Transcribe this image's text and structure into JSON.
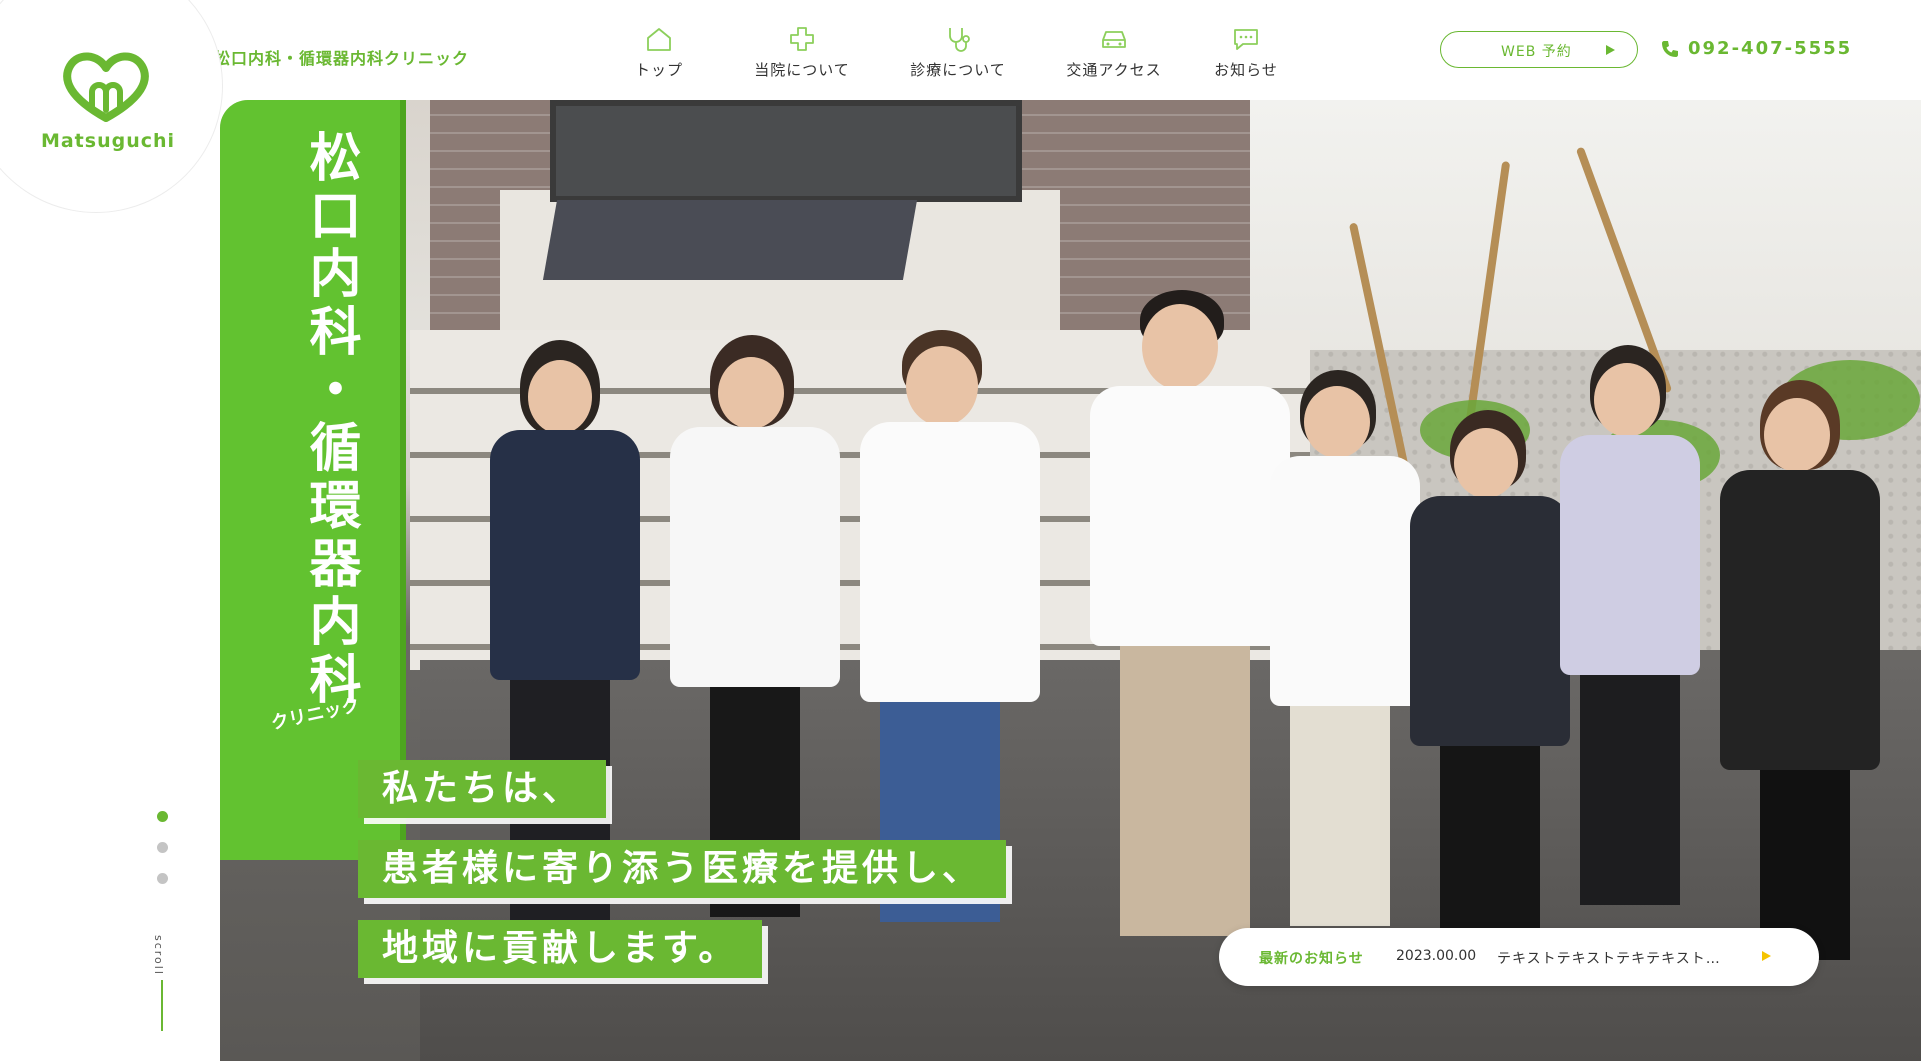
{
  "brand": {
    "logo_text": "Matsuguchi",
    "clinic_name": "松口内科・循環器内科クリニック",
    "accent_color": "#6ab832"
  },
  "nav": {
    "items": [
      {
        "label": "トップ",
        "icon": "home-icon"
      },
      {
        "label": "当院について",
        "icon": "cross-icon"
      },
      {
        "label": "診療について",
        "icon": "stethoscope-icon"
      },
      {
        "label": "交通アクセス",
        "icon": "car-icon"
      },
      {
        "label": "お知らせ",
        "icon": "chat-bubble-icon"
      }
    ]
  },
  "header": {
    "web_reservation_label": "WEB 予約",
    "phone": "092-407-5555"
  },
  "hero": {
    "sign_text": "松口内科・循環器内科",
    "sign_sub": "クリニック",
    "tagline": [
      "私たちは、",
      "患者様に寄り添う医療を提供し、",
      "地域に貢献します。"
    ]
  },
  "news": {
    "label": "最新のお知らせ",
    "date": "2023.00.00",
    "text": "テキストテキストテキテキスト…"
  },
  "slider": {
    "count": 3,
    "active_index": 0,
    "scroll_label": "scroll"
  }
}
